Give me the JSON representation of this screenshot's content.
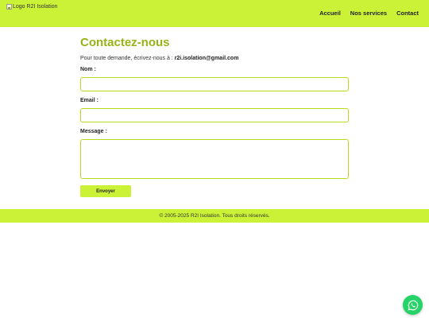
{
  "header": {
    "logo_alt": "Logo R2I Isolation",
    "nav": [
      {
        "label": "Accueil"
      },
      {
        "label": "Nos services"
      },
      {
        "label": "Contact"
      }
    ]
  },
  "contact": {
    "title": "Contactez-nous",
    "intro_text": "Pour toute demande, écrivez-nous à : ",
    "email": "r2i.isolation@gmail.com",
    "fields": {
      "name_label": "Nom :",
      "name_value": "",
      "email_label": "Email :",
      "email_value": "",
      "message_label": "Message :",
      "message_value": ""
    },
    "submit_label": "Envoyer"
  },
  "footer": {
    "copyright": "© 2005-2025 R2I Isolation. Tous droits réservés."
  },
  "floating": {
    "icon": "whatsapp-icon",
    "color": "#25d366"
  },
  "colors": {
    "brand": "#ccf237",
    "title": "#96b416"
  }
}
